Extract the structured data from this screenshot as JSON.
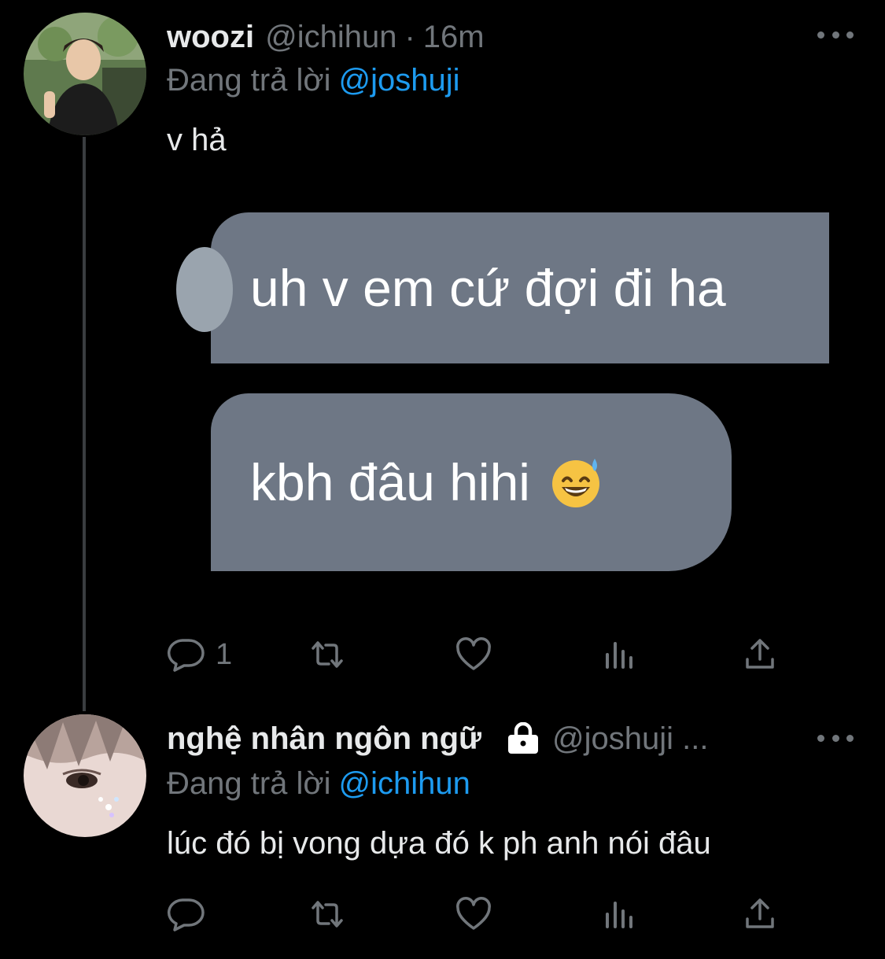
{
  "tweets": [
    {
      "display_name": "woozi",
      "handle": "@ichihun",
      "separator": "·",
      "time": "16m",
      "replying_prefix": "Đang trả lời",
      "replying_to": "@joshuji",
      "text": "v hả",
      "media": {
        "bubble1": "uh v em cứ đợi đi ha",
        "bubble2": "kbh đâu hihi",
        "bubble2_emoji": "grinning-face-with-sweat-emoji"
      },
      "reply_count": "1"
    },
    {
      "display_name": "nghệ nhân ngôn ngữ",
      "handle": "@joshuji ...",
      "protected": true,
      "replying_prefix": "Đang trả lời",
      "replying_to": "@ichihun",
      "text": "lúc đó bị vong dựa đó k ph anh nói đâu",
      "reply_count": ""
    }
  ],
  "colors": {
    "background": "#000000",
    "text": "#e7e9ea",
    "muted": "#71767b",
    "mention": "#1d9bf0",
    "bubble": "#6e7785"
  }
}
